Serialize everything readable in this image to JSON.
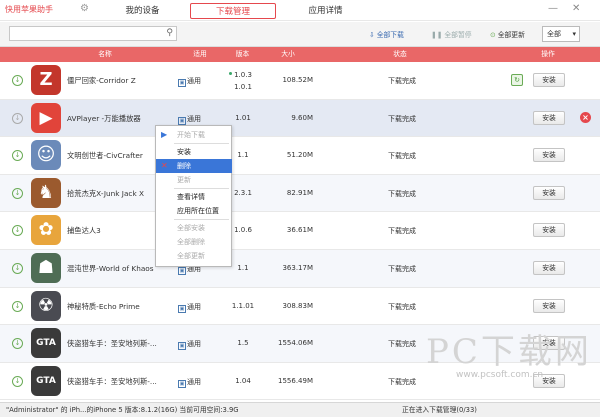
{
  "app": {
    "title": "快用苹果助手",
    "gear_icon": "⚙",
    "tabs": [
      {
        "label": "我的设备"
      },
      {
        "label": "下载管理"
      },
      {
        "label": "应用详情"
      }
    ],
    "window_controls": {
      "minimize": "—",
      "close": "✕"
    }
  },
  "toolbar": {
    "search_placeholder": "",
    "batch_download": "全部下载",
    "pause_all": "全部暂停",
    "update_all": "全部更新",
    "select_filter": "全部"
  },
  "table": {
    "headers": {
      "name": "名称",
      "compat": "适用",
      "version": "版本",
      "size": "大小",
      "status": "状态",
      "action": "操作"
    },
    "rows": [
      {
        "name": "僵尸回家-Corridor Z",
        "compat": "通用",
        "version_a": "1.0.3",
        "version_b": "1.0.1",
        "size": "108.52M",
        "status": "下载完成",
        "action": "安装",
        "icon_color": "#c3362b",
        "icon_glyph": "Z",
        "icon_name": "corridor-z-icon"
      },
      {
        "name": "AVPlayer -万能播放器",
        "compat": "通用",
        "version": "1.01",
        "size": "9.60M",
        "status": "下载完成",
        "action": "安装",
        "icon_color": "#e1443a",
        "icon_glyph": "▶",
        "icon_name": "avplayer-icon"
      },
      {
        "name": "文明创世者-CivCrafter",
        "compat": "通用",
        "version": "1.1",
        "size": "51.20M",
        "status": "下载完成",
        "action": "安装",
        "icon_color": "#6b8ab9",
        "icon_glyph": "☺",
        "icon_name": "civcrafter-icon"
      },
      {
        "name": "拾荒杰克X-Junk Jack X",
        "compat": "通用",
        "version": "2.3.1",
        "size": "82.91M",
        "status": "下载完成",
        "action": "安装",
        "icon_color": "#9b5a2e",
        "icon_glyph": "♞",
        "icon_name": "junk-jack-icon"
      },
      {
        "name": "捕鱼达人3",
        "compat": "通用",
        "version": "1.0.6",
        "size": "36.61M",
        "status": "下载完成",
        "action": "安装",
        "icon_color": "#e8a53c",
        "icon_glyph": "✿",
        "icon_name": "fishing-icon"
      },
      {
        "name": "混沌世界-World of Khaos",
        "compat": "通用",
        "version": "1.1",
        "size": "363.17M",
        "status": "下载完成",
        "action": "安装",
        "icon_color": "#4f6d55",
        "icon_glyph": "☗",
        "icon_name": "world-of-khaos-icon"
      },
      {
        "name": "神秘特质-Echo Prime",
        "compat": "通用",
        "version": "1.1.01",
        "size": "308.83M",
        "status": "下载完成",
        "action": "安装",
        "icon_color": "#4a4b52",
        "icon_glyph": "☢",
        "icon_name": "echo-prime-icon"
      },
      {
        "name": "侠盗猎车手：圣安地列斯-...",
        "compat": "通用",
        "version": "1.5",
        "size": "1554.06M",
        "status": "下载完成",
        "action": "安装",
        "icon_color": "#3a3a3a",
        "icon_glyph": "GTA",
        "icon_name": "gta-icon"
      },
      {
        "name": "侠盗猎车手：圣安地列斯-...",
        "compat": "通用",
        "version": "1.04",
        "size": "1556.49M",
        "status": "下载完成",
        "action": "安装",
        "icon_color": "#3a3a3a",
        "icon_glyph": "GTA",
        "icon_name": "gta-icon"
      }
    ]
  },
  "context_menu": {
    "items": [
      {
        "label": "开始下载",
        "disabled": true,
        "icon": "▶"
      },
      {
        "label": "安装",
        "disabled": false
      },
      {
        "label": "删除",
        "disabled": false,
        "active": true,
        "icon": "✕"
      },
      {
        "label": "更新",
        "disabled": true
      },
      {
        "label": "查看详情",
        "disabled": false
      },
      {
        "label": "应用所在位置",
        "disabled": false
      },
      {
        "label": "全部安装",
        "disabled": true
      },
      {
        "label": "全部删除",
        "disabled": true
      },
      {
        "label": "全部更新",
        "disabled": true
      }
    ]
  },
  "statusbar": {
    "device": "\"Administrator\" 的 iPh...的iPhone 5  版本:8.1.2(16G) 当前可用空间:3.9G",
    "right": "正在进入下载管理(0/33)"
  },
  "watermark": {
    "big": "PC下载网",
    "small": "www.pcsoft.com.cn"
  },
  "colors": {
    "accent": "#e5484d",
    "header_bg": "#e96767",
    "check_green": "#6aab56",
    "menu_active": "#3a76d8"
  }
}
